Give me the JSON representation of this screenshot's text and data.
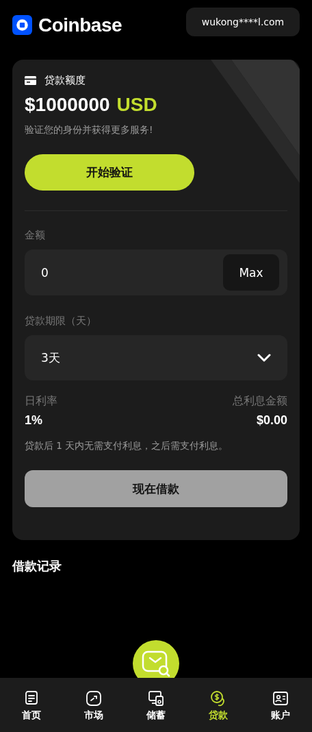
{
  "header": {
    "brand": "Coinbase",
    "account": "wukong****l.com"
  },
  "credit": {
    "label": "贷款额度",
    "amount": "$1000000",
    "currency": "USD",
    "note": "验证您的身份并获得更多服务!",
    "verify_button": "开始验证"
  },
  "form": {
    "amount_label": "金额",
    "amount_value": "0",
    "max_button": "Max",
    "term_label": "贷款期限（天）",
    "term_value": "3天",
    "daily_rate_label": "日利率",
    "daily_rate": "1%",
    "total_interest_label": "总利息金额",
    "total_interest": "$0.00",
    "notice": "贷款后 1 天内无需支付利息，之后需支付利息。",
    "submit_button": "现在借款",
    "submit_disabled": true
  },
  "records": {
    "title": "借款记录"
  },
  "nav": [
    {
      "label": "首页",
      "kind": "home",
      "selected": false
    },
    {
      "label": "市场",
      "kind": "market",
      "selected": false
    },
    {
      "label": "储蓄",
      "kind": "savings",
      "selected": false
    },
    {
      "label": "贷款",
      "kind": "loan",
      "selected": true
    },
    {
      "label": "账户",
      "kind": "account",
      "selected": false
    }
  ]
}
